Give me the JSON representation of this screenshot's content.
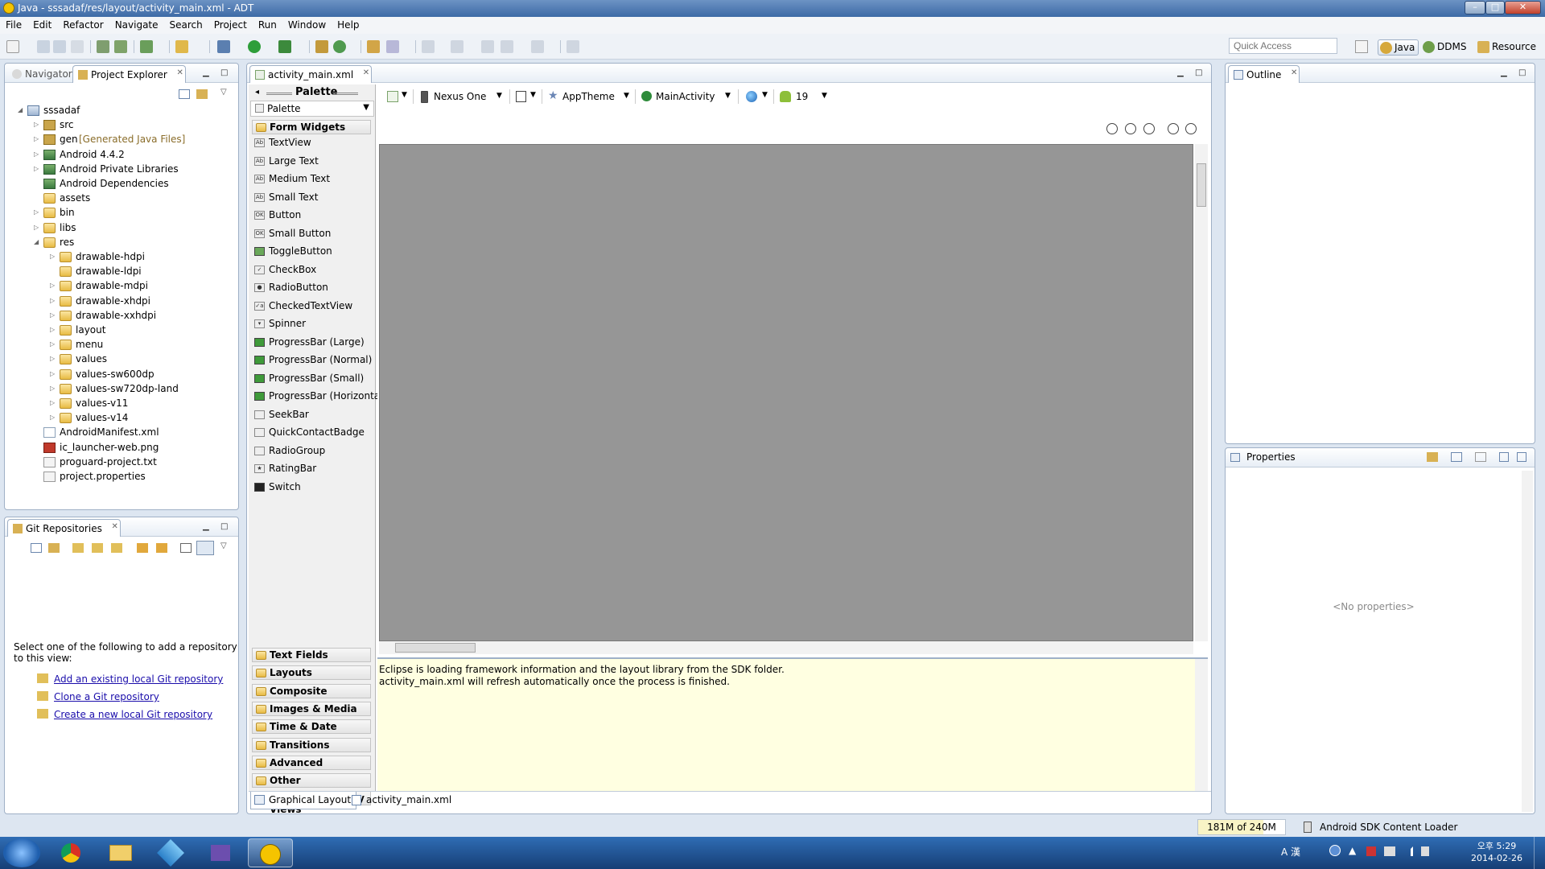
{
  "window": {
    "title": "Java - sssadaf/res/layout/activity_main.xml - ADT"
  },
  "menu": [
    "File",
    "Edit",
    "Refactor",
    "Navigate",
    "Search",
    "Project",
    "Run",
    "Window",
    "Help"
  ],
  "toolbar": {
    "quick_access_placeholder": "Quick Access"
  },
  "perspectives": [
    "Java",
    "DDMS",
    "Resource"
  ],
  "left_panel": {
    "tabs": [
      "Navigator",
      "Project Explorer"
    ],
    "tree": [
      {
        "label": "sssadaf",
        "indent": 0,
        "icon": "project-icon",
        "twisty": "open"
      },
      {
        "label": "src",
        "indent": 1,
        "icon": "package-folder-icon",
        "twisty": "closed"
      },
      {
        "label": "gen",
        "suffix": "[Generated Java Files]",
        "indent": 1,
        "icon": "package-folder-icon",
        "twisty": "closed"
      },
      {
        "label": "Android 4.4.2",
        "indent": 1,
        "icon": "library-icon",
        "twisty": "closed"
      },
      {
        "label": "Android Private Libraries",
        "indent": 1,
        "icon": "library-icon",
        "twisty": "closed"
      },
      {
        "label": "Android Dependencies",
        "indent": 1,
        "icon": "library-icon",
        "twisty": "none"
      },
      {
        "label": "assets",
        "indent": 1,
        "icon": "folder-icon",
        "twisty": "none"
      },
      {
        "label": "bin",
        "indent": 1,
        "icon": "folder-icon",
        "twisty": "closed"
      },
      {
        "label": "libs",
        "indent": 1,
        "icon": "folder-icon",
        "twisty": "closed"
      },
      {
        "label": "res",
        "indent": 1,
        "icon": "folder-icon",
        "twisty": "open"
      },
      {
        "label": "drawable-hdpi",
        "indent": 2,
        "icon": "folder-icon",
        "twisty": "closed"
      },
      {
        "label": "drawable-ldpi",
        "indent": 2,
        "icon": "folder-icon",
        "twisty": "none"
      },
      {
        "label": "drawable-mdpi",
        "indent": 2,
        "icon": "folder-icon",
        "twisty": "closed"
      },
      {
        "label": "drawable-xhdpi",
        "indent": 2,
        "icon": "folder-icon",
        "twisty": "closed"
      },
      {
        "label": "drawable-xxhdpi",
        "indent": 2,
        "icon": "folder-icon",
        "twisty": "closed"
      },
      {
        "label": "layout",
        "indent": 2,
        "icon": "folder-icon",
        "twisty": "closed"
      },
      {
        "label": "menu",
        "indent": 2,
        "icon": "folder-icon",
        "twisty": "closed"
      },
      {
        "label": "values",
        "indent": 2,
        "icon": "folder-icon",
        "twisty": "closed"
      },
      {
        "label": "values-sw600dp",
        "indent": 2,
        "icon": "folder-icon",
        "twisty": "closed"
      },
      {
        "label": "values-sw720dp-land",
        "indent": 2,
        "icon": "folder-icon",
        "twisty": "closed"
      },
      {
        "label": "values-v11",
        "indent": 2,
        "icon": "folder-icon",
        "twisty": "closed"
      },
      {
        "label": "values-v14",
        "indent": 2,
        "icon": "folder-icon",
        "twisty": "closed"
      },
      {
        "label": "AndroidManifest.xml",
        "indent": 1,
        "icon": "xml-file-icon",
        "twisty": "none"
      },
      {
        "label": "ic_launcher-web.png",
        "indent": 1,
        "icon": "png-file-icon",
        "twisty": "none"
      },
      {
        "label": "proguard-project.txt",
        "indent": 1,
        "icon": "text-file-icon",
        "twisty": "none"
      },
      {
        "label": "project.properties",
        "indent": 1,
        "icon": "text-file-icon",
        "twisty": "none"
      }
    ]
  },
  "git_panel": {
    "tab": "Git Repositories",
    "message": "Select one of the following to add a repository to this view:",
    "links": [
      "Add an existing local Git repository",
      "Clone a Git repository",
      "Create a new local Git repository"
    ]
  },
  "editor": {
    "tab": "activity_main.xml",
    "palette_header": "Palette",
    "palette_dropdown": "Palette",
    "categories_top": "Form Widgets",
    "widgets": [
      {
        "label": "TextView",
        "icon": "Ab"
      },
      {
        "label": "Large Text",
        "icon": "Ab"
      },
      {
        "label": "Medium Text",
        "icon": "Ab"
      },
      {
        "label": "Small Text",
        "icon": "Ab"
      },
      {
        "label": "Button",
        "icon": "OK"
      },
      {
        "label": "Small Button",
        "icon": "OK"
      },
      {
        "label": "ToggleButton",
        "icon": ""
      },
      {
        "label": "CheckBox",
        "icon": "✓"
      },
      {
        "label": "RadioButton",
        "icon": "●"
      },
      {
        "label": "CheckedTextView",
        "icon": "✓a"
      },
      {
        "label": "Spinner",
        "icon": "▾"
      },
      {
        "label": "ProgressBar (Large)",
        "icon": ""
      },
      {
        "label": "ProgressBar (Normal)",
        "icon": ""
      },
      {
        "label": "ProgressBar (Small)",
        "icon": ""
      },
      {
        "label": "ProgressBar (Horizontal)",
        "icon": ""
      },
      {
        "label": "SeekBar",
        "icon": ""
      },
      {
        "label": "QuickContactBadge",
        "icon": ""
      },
      {
        "label": "RadioGroup",
        "icon": ""
      },
      {
        "label": "RatingBar",
        "icon": "★"
      },
      {
        "label": "Switch",
        "icon": ""
      }
    ],
    "categories_bottom": [
      "Text Fields",
      "Layouts",
      "Composite",
      "Images & Media",
      "Time & Date",
      "Transitions",
      "Advanced",
      "Other",
      "Custom & Library Views"
    ],
    "device": "Nexus One",
    "theme": "AppTheme",
    "activity": "MainActivity",
    "api": "19",
    "message_line1": "Eclipse is loading framework information and the layout library from the SDK folder.",
    "message_line2": "activity_main.xml will refresh automatically once the process is finished.",
    "bottom_tabs": [
      "Graphical Layout",
      "activity_main.xml"
    ]
  },
  "outline": {
    "tab": "Outline"
  },
  "properties": {
    "title": "Properties",
    "empty": "<No properties>"
  },
  "status": {
    "heap": "181M of 240M",
    "task": "Android SDK Content Loader"
  },
  "tray": {
    "time": "오후 5:29",
    "date": "2014-02-26",
    "ime": "A 漢"
  }
}
